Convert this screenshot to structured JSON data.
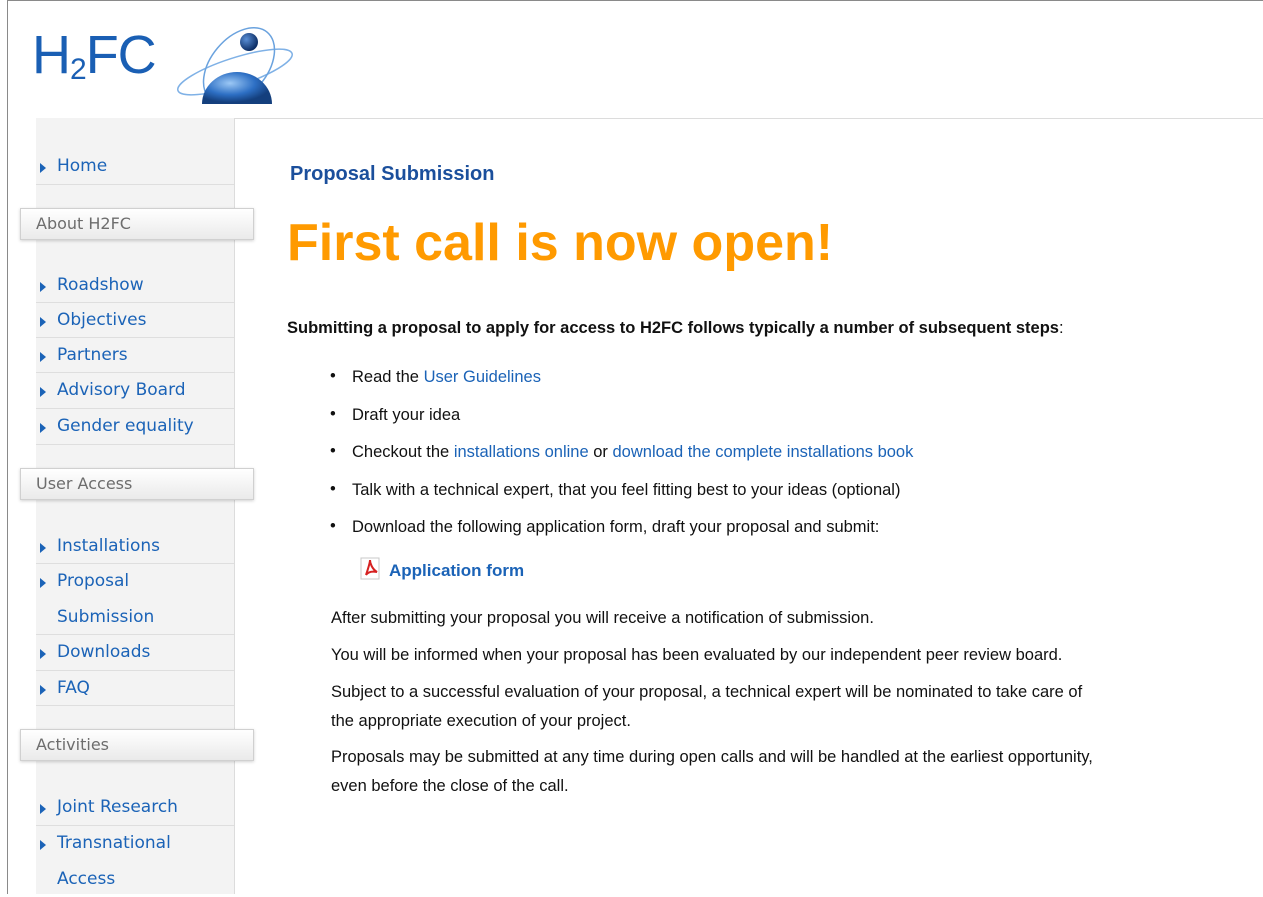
{
  "logo": {
    "text_main": "H",
    "text_sub": "2",
    "text_end": "FC"
  },
  "sidebar": {
    "home": "Home",
    "sections": [
      {
        "title": "About H2FC",
        "items": [
          "Roadshow",
          "Objectives",
          "Partners",
          "Advisory Board",
          "Gender equality"
        ]
      },
      {
        "title": "User Access",
        "items": [
          "Installations",
          "Proposal Submission",
          "Downloads",
          "FAQ"
        ]
      },
      {
        "title": "Activities",
        "items": [
          "Joint Research",
          "Transnational Access"
        ]
      }
    ],
    "split_items": {
      "proposal_line1": "Proposal",
      "proposal_line2": "Submission",
      "transnational_line1": "Transnational",
      "transnational_line2": "Access"
    }
  },
  "main": {
    "page_title": "Proposal Submission",
    "headline": "First call is now open!",
    "intro": "Submitting a proposal to apply for access to H2FC follows typically a number of subsequent steps",
    "intro_colon": ":",
    "bullet": "•",
    "steps": {
      "s1_prefix": "Read the ",
      "s1_link": "User Guidelines",
      "s2": "Draft your idea",
      "s3_prefix": "Checkout the ",
      "s3_link1": "installations online",
      "s3_mid": " or ",
      "s3_link2": "download the complete installations book",
      "s4": "Talk with a technical expert, that you feel fitting best to your ideas (optional)",
      "s5": "Download the following application form, draft your proposal and submit:"
    },
    "application_form": "Application form",
    "paragraphs": [
      "After submitting your proposal you will receive a notification of submission.",
      "You will be informed when your proposal has been evaluated by our independent peer review board.",
      "Subject to a successful evaluation of your proposal, a technical expert will be nominated to take care of",
      "the appropriate execution of your project.",
      "Proposals may be submitted at any time during open calls and will be handled at the earliest opportunity,",
      "even before the close of the call."
    ]
  },
  "colors": {
    "link": "#1b63b7",
    "headline": "#ff9a00",
    "title": "#1b4f9c"
  }
}
